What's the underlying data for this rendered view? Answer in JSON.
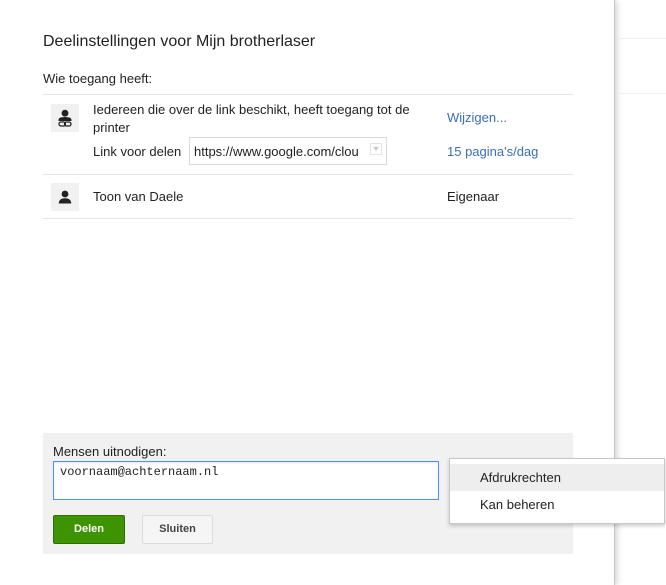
{
  "dialog": {
    "title": "Deelinstellingen voor Mijn brotherlaser",
    "who_has_access_label": "Wie toegang heeft:"
  },
  "access_list": {
    "link_row": {
      "icon": "link-person-icon",
      "description": "Iedereen die over de link beschikt, heeft toegang tot de printer",
      "share_link_label": "Link voor delen",
      "share_link_value": "https://www.google.com/clou",
      "change_link": "Wijzigen...",
      "quota": "15 pagina's/dag"
    },
    "owner_row": {
      "icon": "person-icon",
      "name": "Toon van Daele",
      "role": "Eigenaar"
    }
  },
  "invite": {
    "label": "Mensen uitnodigen:",
    "input_value": "voornaam@achternaam.nl",
    "share_button": "Delen",
    "close_button": "Sluiten",
    "share_button_color": "#3d9400"
  },
  "permission_menu": {
    "items": [
      "Afdrukrechten",
      "Kan beheren"
    ],
    "highlighted_index": 0
  },
  "colors": {
    "link": "#3b6fb6",
    "panel_bg": "#f1f1f1",
    "focus_border": "#4d90fe"
  }
}
